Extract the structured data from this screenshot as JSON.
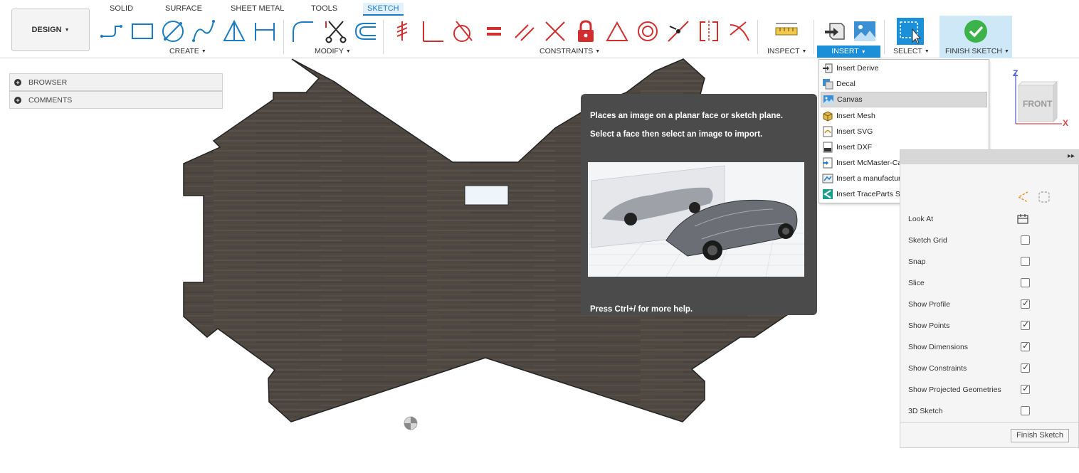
{
  "toolbar": {
    "workspace": "DESIGN",
    "tabs": [
      "SOLID",
      "SURFACE",
      "SHEET METAL",
      "TOOLS",
      "SKETCH"
    ],
    "groups": {
      "create": "CREATE",
      "modify": "MODIFY",
      "constraints": "CONSTRAINTS",
      "inspect": "INSPECT",
      "insert": "INSERT",
      "select": "SELECT",
      "finish": "FINISH SKETCH"
    }
  },
  "browser": {
    "browser_label": "BROWSER",
    "comments_label": "COMMENTS"
  },
  "insert_menu": {
    "items": [
      "Insert Derive",
      "Decal",
      "Canvas",
      "Insert Mesh",
      "Insert SVG",
      "Insert DXF",
      "Insert McMaster-Carr Component",
      "Insert a manufacturer part",
      "Insert TraceParts Supplier Components"
    ],
    "highlighted_index": 2
  },
  "tooltip": {
    "line1": "Places an image on a planar face or sketch plane.",
    "line2": "Select a face then select an image to import.",
    "help": "Press Ctrl+/ for more help."
  },
  "viewcube": {
    "face": "FRONT",
    "axis_z": "Z",
    "axis_x": "X"
  },
  "palette": {
    "look_at": "Look At",
    "options": [
      {
        "label": "Sketch Grid",
        "checked": false
      },
      {
        "label": "Snap",
        "checked": false
      },
      {
        "label": "Slice",
        "checked": false
      },
      {
        "label": "Show Profile",
        "checked": true
      },
      {
        "label": "Show Points",
        "checked": true
      },
      {
        "label": "Show Dimensions",
        "checked": true
      },
      {
        "label": "Show Constraints",
        "checked": true
      },
      {
        "label": "Show Projected Geometries",
        "checked": true
      },
      {
        "label": "3D Sketch",
        "checked": false
      }
    ],
    "finish_button": "Finish Sketch"
  },
  "colors": {
    "accent": "#1b8fd8",
    "wood": "#4e4841",
    "tooltip_bg": "#4b4b4b",
    "constraint_red": "#d12f2f",
    "finish_green": "#3bb34a"
  }
}
